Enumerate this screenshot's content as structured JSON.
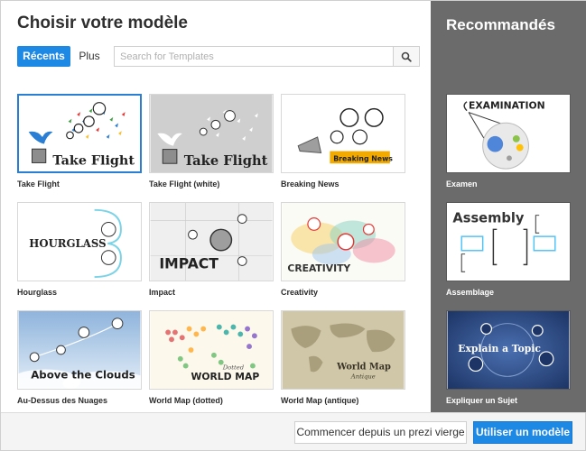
{
  "dialog": {
    "title": "Choisir votre modèle",
    "tabs": [
      {
        "label": "Récents",
        "active": true
      },
      {
        "label": "Plus",
        "active": false
      }
    ],
    "search": {
      "placeholder": "Search for Templates",
      "value": ""
    }
  },
  "templates": [
    {
      "label": "Take Flight",
      "thumb_text": "Take Flight",
      "selected": true
    },
    {
      "label": "Take Flight (white)",
      "thumb_text": "Take Flight"
    },
    {
      "label": "Breaking News",
      "thumb_text": "Breaking News"
    },
    {
      "label": "Hourglass",
      "thumb_text": "HOURGLASS"
    },
    {
      "label": "Impact",
      "thumb_text": "IMPACT"
    },
    {
      "label": "Creativity",
      "thumb_text": "CREATIVITY"
    },
    {
      "label": "Au-Dessus des Nuages",
      "thumb_text": "Above the Clouds"
    },
    {
      "label": "World Map (dotted)",
      "thumb_text": "WORLD MAP",
      "thumb_sub": "Dotted"
    },
    {
      "label": "World Map (antique)",
      "thumb_text": "World Map",
      "thumb_sub": "Antique"
    }
  ],
  "recommended": {
    "title": "Recommandés",
    "items": [
      {
        "label": "Examen",
        "thumb_text": "EXAMINATION"
      },
      {
        "label": "Assemblage",
        "thumb_text": "Assembly"
      },
      {
        "label": "Expliquer un Sujet",
        "thumb_text": "Explain a Topic"
      }
    ]
  },
  "footer": {
    "blank_button": "Commencer depuis un prezi vierge",
    "use_button": "Utiliser un modèle"
  },
  "colors": {
    "accent": "#1e88e5",
    "sidebar": "#6b6b6b",
    "selected_border": "#2a7fd4"
  },
  "icons": {
    "search": "magnifier-icon"
  }
}
